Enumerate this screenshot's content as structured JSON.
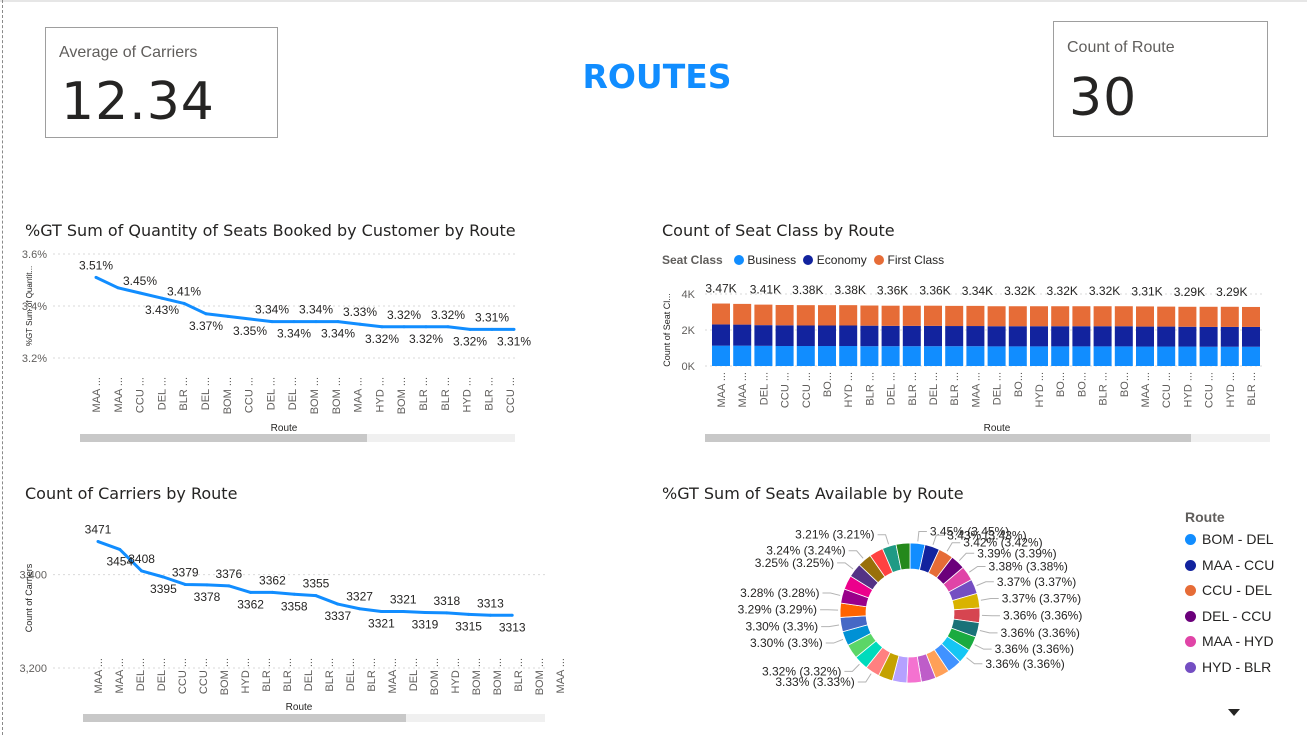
{
  "header": {
    "title": "ROUTES",
    "card_left": {
      "label": "Average of Carriers",
      "value": "12.34"
    },
    "card_right": {
      "label": "Count of Route",
      "value": "30"
    }
  },
  "colors": {
    "accent": "#118dff",
    "business": "#118dff",
    "economy": "#12239e",
    "first_class": "#e66c37"
  },
  "chart_data": [
    {
      "id": "seats_booked",
      "type": "line",
      "title": "%GT Sum of Quantity of Seats Booked by Customer by Route",
      "xlabel": "Route",
      "ylabel": "%GT Sum of Quantit...",
      "yticks": [
        "3.6%",
        "3.4%",
        "3.2%"
      ],
      "ylim": [
        3.2,
        3.6
      ],
      "categories": [
        "MAA ...",
        "MAA ...",
        "CCU ...",
        "DEL ...",
        "BLR ...",
        "DEL ...",
        "BOM ...",
        "CCU ...",
        "DEL ...",
        "DEL ...",
        "BOM ...",
        "BOM ...",
        "MAA ...",
        "HYD ...",
        "BOM ...",
        "BLR ...",
        "BLR ...",
        "HYD ...",
        "BLR ...",
        "CCU ..."
      ],
      "values": [
        3.51,
        3.47,
        3.45,
        3.43,
        3.41,
        3.37,
        3.36,
        3.35,
        3.34,
        3.34,
        3.34,
        3.34,
        3.33,
        3.32,
        3.32,
        3.32,
        3.32,
        3.31,
        3.31,
        3.31
      ],
      "labels": [
        "3.51%",
        "",
        "3.45%",
        "3.43%",
        "3.41%",
        "3.37%",
        "",
        "3.35%",
        "3.34%",
        "3.34%",
        "3.34%",
        "3.34%",
        "3.33%",
        "3.32%",
        "3.32%",
        "3.32%",
        "3.32%",
        "3.32%",
        "3.31%",
        "3.31%"
      ],
      "scroll_fraction": 0.66
    },
    {
      "id": "seat_class",
      "type": "bar",
      "stacked": true,
      "title": "Count of Seat Class by Route",
      "legend_title": "Seat Class",
      "xlabel": "Route",
      "ylabel": "Count of Seat Cl...",
      "yticks": [
        "4K",
        "2K",
        "0K"
      ],
      "ylim": [
        0,
        4000
      ],
      "categories": [
        "MAA ...",
        "MAA ...",
        "DEL ...",
        "CCU ...",
        "CCU ...",
        "BO...",
        "HYD ...",
        "BLR ...",
        "DEL ...",
        "BLR ...",
        "DEL ...",
        "BLR ...",
        "MAA ...",
        "DEL ...",
        "BO...",
        "HYD ...",
        "BO...",
        "BO...",
        "BLR ...",
        "BO...",
        "MAA ...",
        "CCU ...",
        "HYD ...",
        "CCU ...",
        "HYD ...",
        "BLR ..."
      ],
      "series": [
        {
          "name": "Business",
          "values": [
            1130,
            1130,
            1120,
            1110,
            1110,
            1110,
            1110,
            1100,
            1100,
            1100,
            1100,
            1100,
            1100,
            1090,
            1090,
            1090,
            1090,
            1090,
            1090,
            1090,
            1080,
            1080,
            1080,
            1070,
            1070,
            1070
          ]
        },
        {
          "name": "Economy",
          "values": [
            1180,
            1170,
            1150,
            1150,
            1140,
            1140,
            1140,
            1140,
            1130,
            1130,
            1130,
            1120,
            1120,
            1120,
            1120,
            1120,
            1120,
            1120,
            1120,
            1120,
            1110,
            1110,
            1100,
            1100,
            1100,
            1100
          ]
        },
        {
          "name": "First Class",
          "values": [
            1160,
            1150,
            1140,
            1130,
            1130,
            1130,
            1130,
            1120,
            1120,
            1120,
            1120,
            1120,
            1120,
            1110,
            1110,
            1110,
            1110,
            1110,
            1110,
            1110,
            1120,
            1110,
            1110,
            1120,
            1120,
            1110
          ]
        }
      ],
      "labels": [
        "3.47K",
        "",
        "3.41K",
        "",
        "3.38K",
        "",
        "3.38K",
        "",
        "3.36K",
        "",
        "3.36K",
        "",
        "3.34K",
        "",
        "3.32K",
        "",
        "3.32K",
        "",
        "3.32K",
        "",
        "3.31K",
        "",
        "3.29K",
        "",
        "3.29K",
        ""
      ],
      "scroll_fraction": 0.86
    },
    {
      "id": "carriers",
      "type": "line",
      "title": "Count of Carriers by Route",
      "xlabel": "Route",
      "ylabel": "Count of Carriers",
      "yticks": [
        "3,400",
        "3,200"
      ],
      "ylim": [
        3200,
        3500
      ],
      "categories": [
        "MAA ...",
        "MAA ...",
        "DEL ...",
        "DEL ...",
        "CCU ...",
        "CCU ...",
        "BOM ...",
        "HYD ...",
        "BLR ...",
        "BLR ...",
        "DEL ...",
        "BLR ...",
        "DEL ...",
        "BLR ...",
        "MAA ...",
        "DEL ...",
        "BOM ...",
        "HYD ...",
        "BOM ...",
        "BOM ...",
        "BLR ...",
        "BOM ...",
        "MAA ..."
      ],
      "values": [
        3471,
        3454,
        3408,
        3395,
        3379,
        3378,
        3376,
        3362,
        3362,
        3358,
        3355,
        3337,
        3327,
        3321,
        3321,
        3319,
        3318,
        3315,
        3313,
        3313
      ],
      "labels": [
        "3471",
        "3454",
        "3408",
        "3395",
        "3379",
        "3378",
        "3376",
        "3362",
        "3362",
        "3358",
        "3355",
        "3337",
        "3327",
        "3321",
        "3321",
        "3319",
        "3318",
        "3315",
        "3313",
        "3313"
      ],
      "scroll_fraction": 0.7
    },
    {
      "id": "seats_available",
      "type": "pie",
      "donut": true,
      "title": "%GT Sum of Seats Available by Route",
      "legend_title": "Route",
      "legend": [
        "BOM - DEL",
        "MAA - CCU",
        "CCU - DEL",
        "DEL - CCU",
        "MAA - HYD",
        "HYD - BLR"
      ],
      "values": [
        3.45,
        3.43,
        3.42,
        3.39,
        3.38,
        3.37,
        3.37,
        3.36,
        3.36,
        3.36,
        3.36,
        3.35,
        3.35,
        3.34,
        3.34,
        3.34,
        3.33,
        3.33,
        3.32,
        3.31,
        3.3,
        3.3,
        3.29,
        3.28,
        3.27,
        3.25,
        3.24,
        3.23,
        3.21,
        3.2
      ],
      "slice_labels": [
        "3.45% (3.45%)",
        "3.43% (3.43%)",
        "3.42% (3.42%)",
        "3.39% (3.39%)",
        "3.38% (3.38%)",
        "3.37% (3.37%)",
        "3.37% (3.37%)",
        "3.36% (3.36%)",
        "3.36% (3.36%)",
        "3.36% (3.36%)",
        "3.36% (3.36%)",
        "",
        "",
        "",
        "",
        "",
        "",
        "3.33% (3.33%)",
        "3.32% (3.32%)",
        "",
        "3.30% (3.3%)",
        "3.30% (3.3%)",
        "3.29% (3.29%)",
        "3.28% (3.28%)",
        "",
        "3.25% (3.25%)",
        "3.24% (3.24%)",
        "",
        "3.21% (3.21%)",
        ""
      ],
      "colors": [
        "#118dff",
        "#12239e",
        "#e66c37",
        "#6b007b",
        "#e044a7",
        "#744ec2",
        "#d9b300",
        "#d64550",
        "#197278",
        "#1aab40",
        "#15c6f4",
        "#4092ff",
        "#ffa058",
        "#be5dc9",
        "#f472d0",
        "#b5a1ff",
        "#c4a200",
        "#ff8080",
        "#00dbbc",
        "#5bd667",
        "#0091d5",
        "#4668c5",
        "#ff6300",
        "#99008a",
        "#ec008c",
        "#533285",
        "#99700a",
        "#ff4141",
        "#1f9a85",
        "#25891c"
      ]
    }
  ]
}
